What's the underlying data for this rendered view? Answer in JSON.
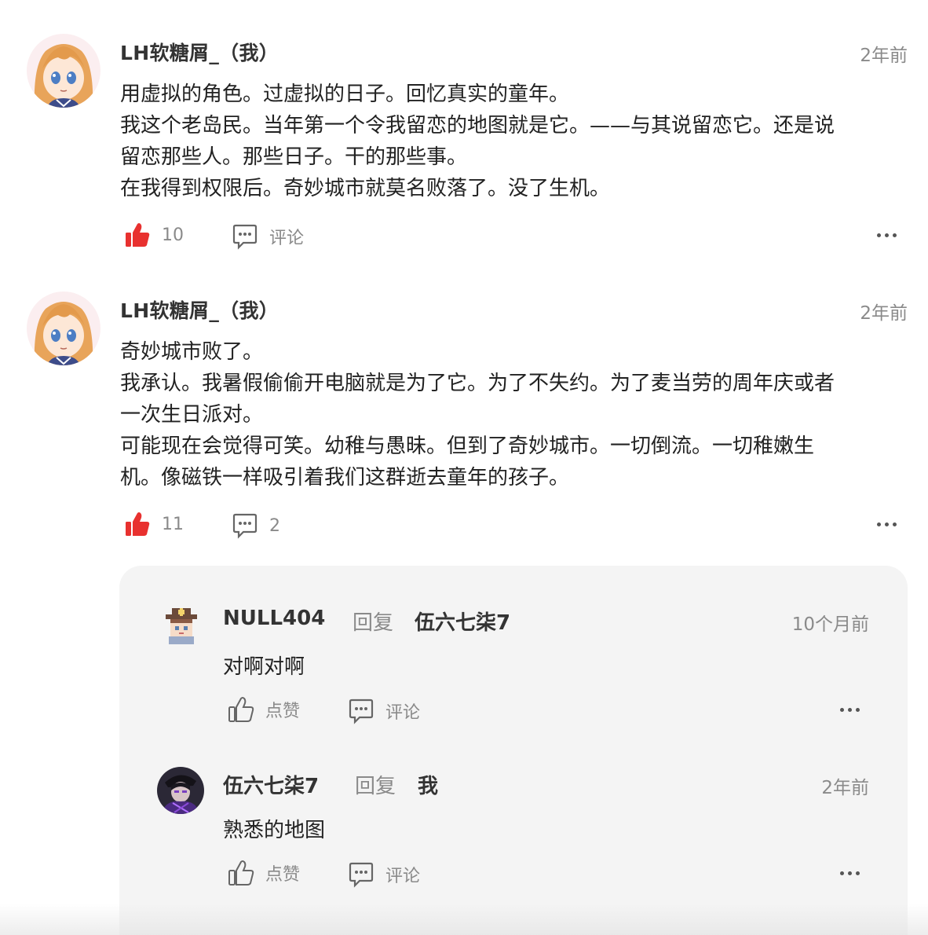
{
  "comments": [
    {
      "username": "LH软糖屑_（我）",
      "time": "2年前",
      "lines": [
        "用虚拟的角色。过虚拟的日子。回忆真实的童年。",
        "我这个老岛民。当年第一个令我留恋的地图就是它。——与其说留恋它。还是说",
        "留恋那些人。那些日子。干的那些事。",
        "在我得到权限后。奇妙城市就莫名败落了。没了生机。"
      ],
      "likes": "10",
      "comment_label": "评论",
      "like_icon": "thumbs-up-filled",
      "comment_icon": "chat-bubble-dots"
    },
    {
      "username": "LH软糖屑_（我）",
      "time": "2年前",
      "lines": [
        "奇妙城市败了。",
        "我承认。我暑假偷偷开电脑就是为了它。为了不失约。为了麦当劳的周年庆或者",
        "一次生日派对。",
        "可能现在会觉得可笑。幼稚与愚昧。但到了奇妙城市。一切倒流。一切稚嫩生",
        "机。像磁铁一样吸引着我们这群逝去童年的孩子。"
      ],
      "likes": "11",
      "comment_count": "2"
    }
  ],
  "replies": [
    {
      "username": "NULL404",
      "reply_word": "回复",
      "target": "伍六七柒7",
      "time": "10个月前",
      "text": "对啊对啊",
      "like_label": "点赞",
      "comment_label": "评论"
    },
    {
      "username": "伍六七柒7",
      "reply_word": "回复",
      "target": "我",
      "time": "2年前",
      "text": "熟悉的地图",
      "like_label": "点赞",
      "comment_label": "评论"
    }
  ],
  "colors": {
    "like_red": "#e8312f",
    "text_gray": "#8a8a8a",
    "panel_bg": "#f4f4f4"
  }
}
